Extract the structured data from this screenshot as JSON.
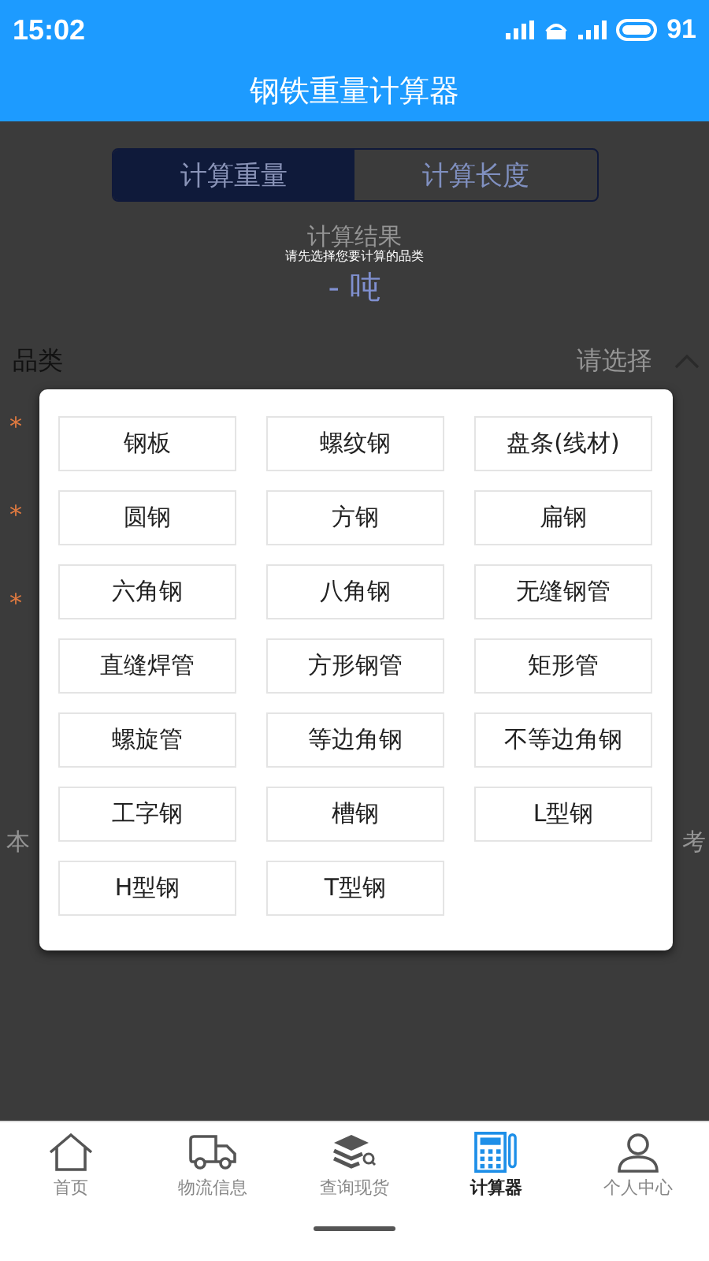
{
  "status_bar": {
    "time": "15:02",
    "battery": "91"
  },
  "header": {
    "title": "钢铁重量计算器"
  },
  "mode_tabs": [
    {
      "label": "计算重量",
      "selected": true
    },
    {
      "label": "计算长度",
      "selected": false
    }
  ],
  "result": {
    "label": "计算结果",
    "value": "- 吨"
  },
  "toast": "请先选择您要计算的品类",
  "category_row": {
    "label": "品类",
    "value": "请选择",
    "expanded": true
  },
  "required_marks": [
    "*",
    "*",
    "*"
  ],
  "note_fragments": [
    "本",
    "考"
  ],
  "category_dialog": {
    "options": [
      {
        "label": "钢板"
      },
      {
        "label": "螺纹钢"
      },
      {
        "label": "盘条(线材)"
      },
      {
        "label": "圆钢"
      },
      {
        "label": "方钢"
      },
      {
        "label": "扁钢"
      },
      {
        "label": "六角钢"
      },
      {
        "label": "八角钢"
      },
      {
        "label": "无缝钢管"
      },
      {
        "label": "直缝焊管"
      },
      {
        "label": "方形钢管"
      },
      {
        "label": "矩形管"
      },
      {
        "label": "螺旋管"
      },
      {
        "label": "等边角钢"
      },
      {
        "label": "不等边角钢"
      },
      {
        "label": "工字钢"
      },
      {
        "label": "槽钢"
      },
      {
        "label": "L型钢"
      },
      {
        "label": "H型钢"
      },
      {
        "label": "T型钢"
      }
    ]
  },
  "bottom_nav": [
    {
      "label": "首页",
      "kind": "home",
      "selected": false
    },
    {
      "label": "物流信息",
      "kind": "truck",
      "selected": false
    },
    {
      "label": "查询现货",
      "kind": "stack",
      "selected": false
    },
    {
      "label": "计算器",
      "kind": "calculator",
      "selected": true
    },
    {
      "label": "个人中心",
      "kind": "person",
      "selected": false
    }
  ]
}
